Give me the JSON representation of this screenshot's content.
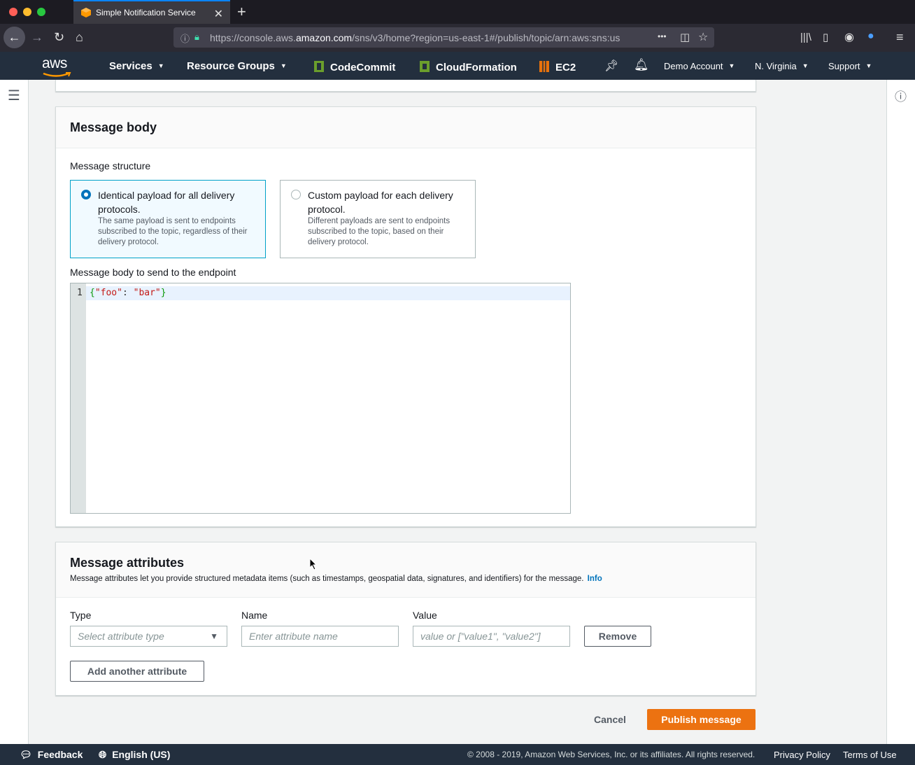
{
  "browser": {
    "tab_title": "Simple Notification Service",
    "new_tab": "+",
    "url_prefix": "https://console.aws.",
    "url_domain": "amazon.com",
    "url_rest": "/sns/v3/home?region=us-east-1#/publish/topic/arn:aws:sns:us",
    "more": "•••"
  },
  "aws_nav": {
    "logo": "aws",
    "services": "Services",
    "resource_groups": "Resource Groups",
    "codecommit": "CodeCommit",
    "cloudformation": "CloudFormation",
    "ec2": "EC2",
    "account": "Demo Account",
    "region": "N. Virginia",
    "support": "Support"
  },
  "message_body": {
    "title": "Message body",
    "structure_label": "Message structure",
    "option_identical_title": "Identical payload for all delivery protocols.",
    "option_identical_desc": "The same payload is sent to endpoints subscribed to the topic, regardless of their delivery protocol.",
    "option_custom_title": "Custom payload for each delivery protocol.",
    "option_custom_desc": "Different payloads are sent to endpoints subscribed to the topic, based on their delivery protocol.",
    "selected_option": "identical",
    "editor_label": "Message body to send to the endpoint",
    "line_number": "1",
    "code": {
      "open": "{",
      "key": "\"foo\"",
      "colon": ": ",
      "value": "\"bar\"",
      "close": "}"
    }
  },
  "message_attributes": {
    "title": "Message attributes",
    "description": "Message attributes let you provide structured metadata items (such as timestamps, geospatial data, signatures, and identifiers) for the message.",
    "info_link": "Info",
    "type_label": "Type",
    "type_placeholder": "Select attribute type",
    "name_label": "Name",
    "name_placeholder": "Enter attribute name",
    "value_label": "Value",
    "value_placeholder": "value or [\"value1\", \"value2\"]",
    "remove_button": "Remove",
    "add_button": "Add another attribute"
  },
  "actions": {
    "cancel": "Cancel",
    "publish": "Publish message"
  },
  "footer": {
    "feedback": "Feedback",
    "language": "English (US)",
    "copyright": "© 2008 - 2019, Amazon Web Services, Inc. or its affiliates. All rights reserved.",
    "privacy": "Privacy Policy",
    "terms": "Terms of Use"
  },
  "colors": {
    "aws_nav_bg": "#232f3e",
    "primary": "#ec7211",
    "selected_border": "#00a1c9",
    "link": "#0073bb"
  }
}
